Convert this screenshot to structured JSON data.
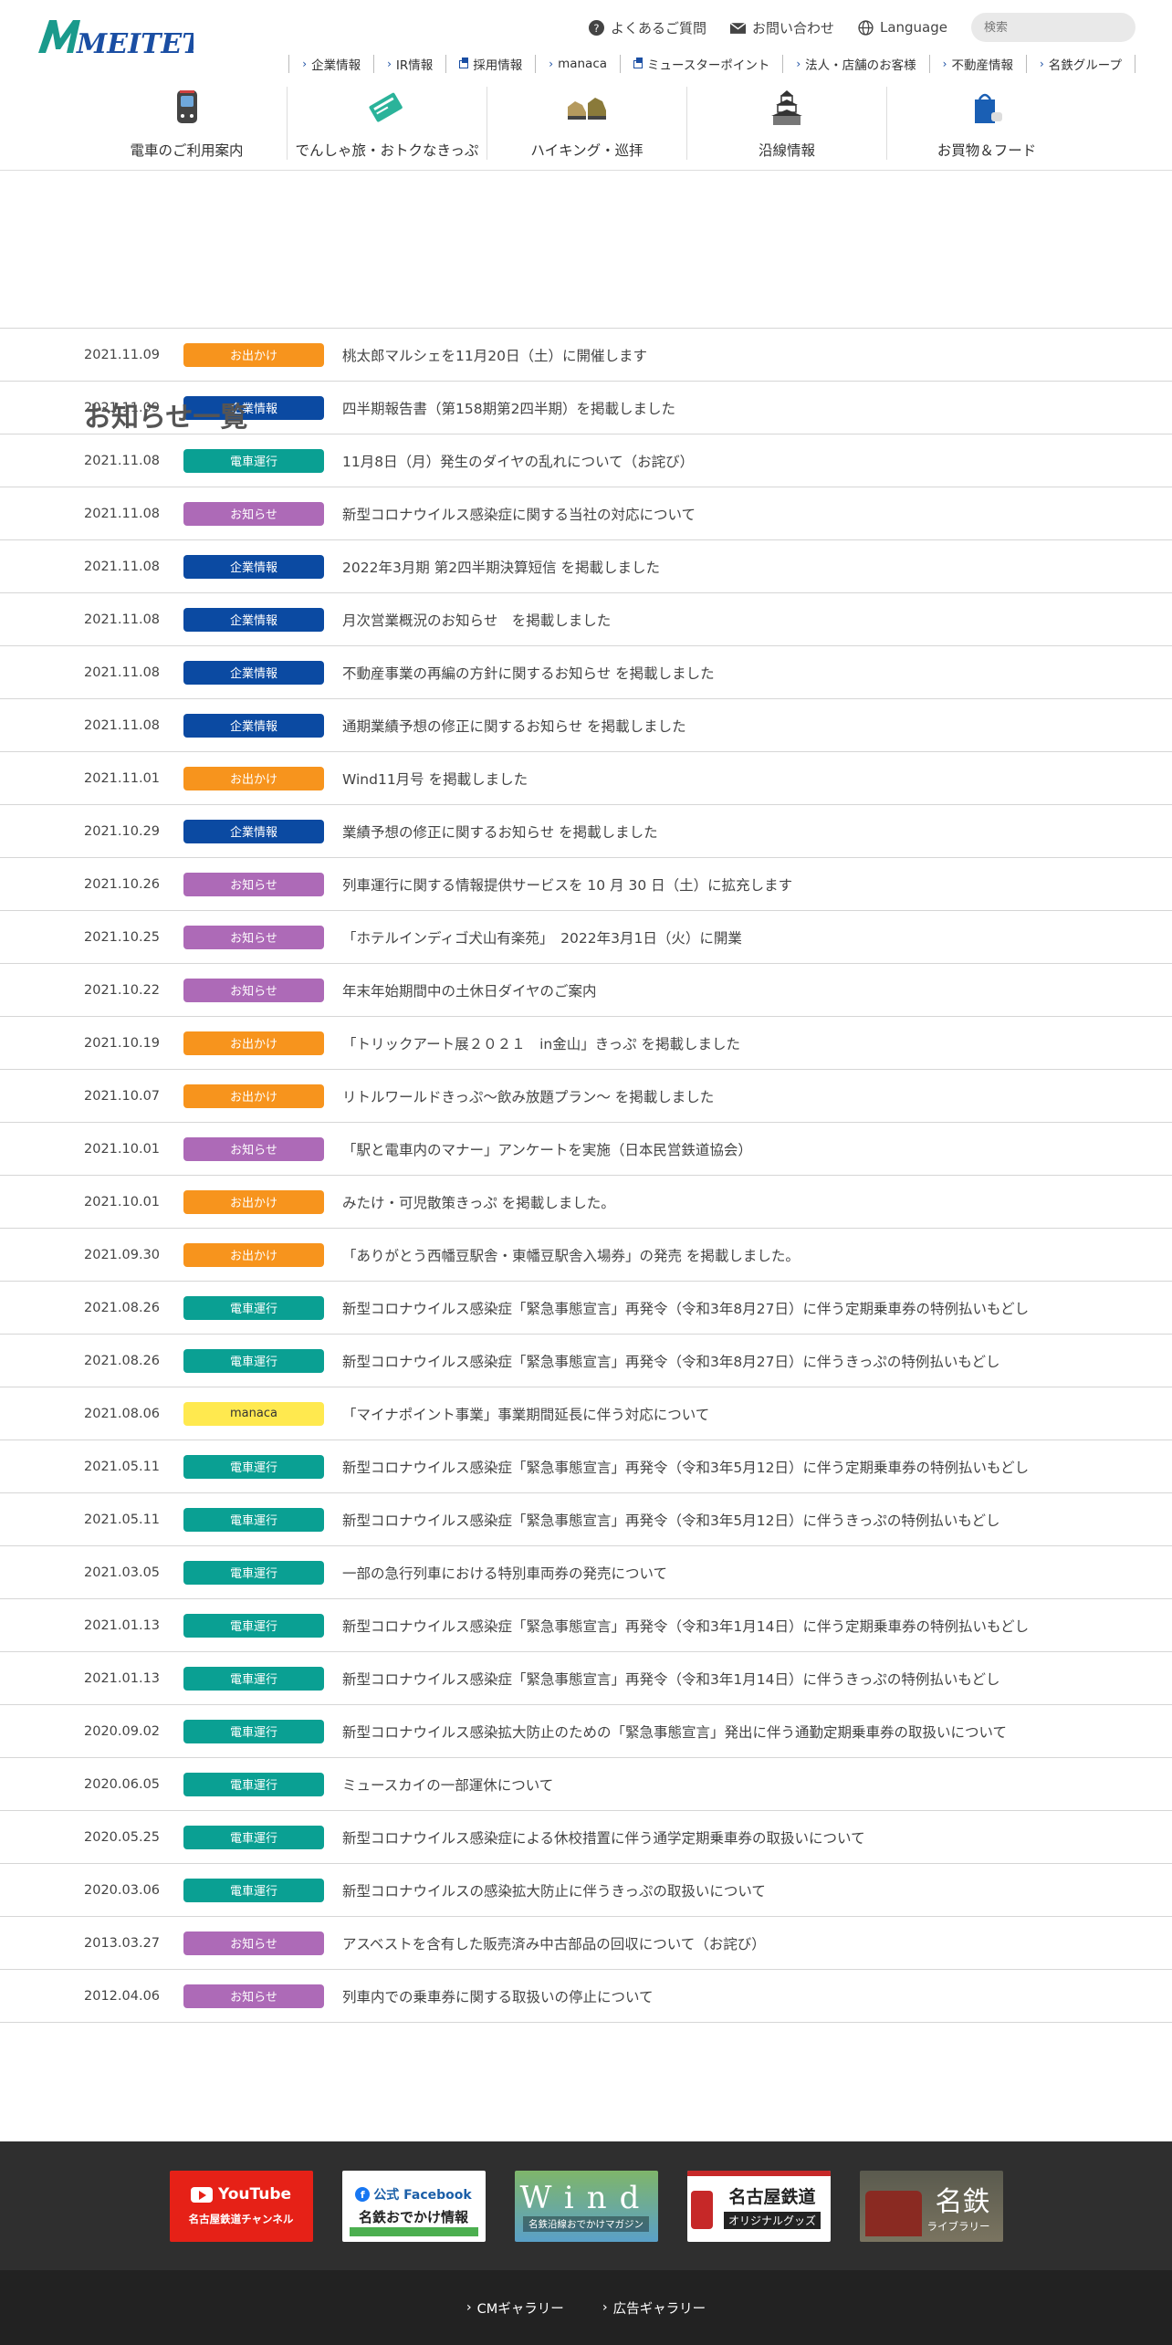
{
  "brand": {
    "logo_text": "MEITETSU",
    "logo_color": "#1a9a8c"
  },
  "util_nav": {
    "faq": "よくあるご質問",
    "contact": "お問い合わせ",
    "language": "Language",
    "search_placeholder": "検索"
  },
  "corp_nav": [
    {
      "label": "企業情報",
      "ext": false
    },
    {
      "label": "IR情報",
      "ext": false
    },
    {
      "label": "採用情報",
      "ext": true
    },
    {
      "label": "manaca",
      "ext": false
    },
    {
      "label": "ミュースターポイント",
      "ext": true
    },
    {
      "label": "法人・店舗のお客様",
      "ext": false
    },
    {
      "label": "不動産情報",
      "ext": false
    },
    {
      "label": "名鉄グループ",
      "ext": false
    }
  ],
  "main_nav": [
    {
      "label": "電車のご利用案内",
      "icon": "train-icon"
    },
    {
      "label": "でんしゃ旅・おトクなきっぷ",
      "icon": "ticket-icon"
    },
    {
      "label": "ハイキング・巡拝",
      "icon": "hiking-boots-icon"
    },
    {
      "label": "沿線情報",
      "icon": "castle-icon"
    },
    {
      "label": "お買物＆フード",
      "icon": "shopping-bag-icon"
    }
  ],
  "page_title": "お知らせ一覧",
  "categories": {
    "odekake": {
      "label": "お出かけ",
      "color": "#f7941d"
    },
    "kigyo": {
      "label": "企業情報",
      "color": "#0b4aa2"
    },
    "densha": {
      "label": "電車運行",
      "color": "#0aa093"
    },
    "oshirase": {
      "label": "お知らせ",
      "color": "#ad6ab7"
    },
    "manaca": {
      "label": "manaca",
      "color": "#ffe94f"
    }
  },
  "news": [
    {
      "date": "2021.11.09",
      "cat": "odekake",
      "title": "桃太郎マルシェを11月20日（土）に開催します"
    },
    {
      "date": "2021.11.09",
      "cat": "kigyo",
      "title": "四半期報告書（第158期第2四半期）を掲載しました"
    },
    {
      "date": "2021.11.08",
      "cat": "densha",
      "title": "11月8日（月）発生のダイヤの乱れについて（お詫び）"
    },
    {
      "date": "2021.11.08",
      "cat": "oshirase",
      "title": "新型コロナウイルス感染症に関する当社の対応について"
    },
    {
      "date": "2021.11.08",
      "cat": "kigyo",
      "title": "2022年3月期 第2四半期決算短信 を掲載しました"
    },
    {
      "date": "2021.11.08",
      "cat": "kigyo",
      "title": "月次営業概況のお知らせ　を掲載しました"
    },
    {
      "date": "2021.11.08",
      "cat": "kigyo",
      "title": "不動産事業の再編の方針に関するお知らせ を掲載しました"
    },
    {
      "date": "2021.11.08",
      "cat": "kigyo",
      "title": "通期業績予想の修正に関するお知らせ を掲載しました"
    },
    {
      "date": "2021.11.01",
      "cat": "odekake",
      "title": "Wind11月号 を掲載しました"
    },
    {
      "date": "2021.10.29",
      "cat": "kigyo",
      "title": "業績予想の修正に関するお知らせ を掲載しました"
    },
    {
      "date": "2021.10.26",
      "cat": "oshirase",
      "title": "列車運行に関する情報提供サービスを 10 月 30 日（土）に拡充します"
    },
    {
      "date": "2021.10.25",
      "cat": "oshirase",
      "title": "「ホテルインディゴ犬山有楽苑」　2022年3月1日（火）に開業"
    },
    {
      "date": "2021.10.22",
      "cat": "oshirase",
      "title": "年末年始期間中の土休日ダイヤのご案内"
    },
    {
      "date": "2021.10.19",
      "cat": "odekake",
      "title": "「トリックアート展２０２１　in金山」きっぷ を掲載しました"
    },
    {
      "date": "2021.10.07",
      "cat": "odekake",
      "title": "リトルワールドきっぷ～飲み放題プラン～ を掲載しました"
    },
    {
      "date": "2021.10.01",
      "cat": "oshirase",
      "title": "「駅と電車内のマナー」アンケートを実施（日本民営鉄道協会）"
    },
    {
      "date": "2021.10.01",
      "cat": "odekake",
      "title": "みたけ・可児散策きっぷ を掲載しました。"
    },
    {
      "date": "2021.09.30",
      "cat": "odekake",
      "title": "「ありがとう西幡豆駅舎・東幡豆駅舎入場券」の発売 を掲載しました。"
    },
    {
      "date": "2021.08.26",
      "cat": "densha",
      "title": "新型コロナウイルス感染症「緊急事態宣言」再発令（令和3年8月27日）に伴う定期乗車券の特例払いもどし"
    },
    {
      "date": "2021.08.26",
      "cat": "densha",
      "title": "新型コロナウイルス感染症「緊急事態宣言」再発令（令和3年8月27日）に伴うきっぷの特例払いもどし"
    },
    {
      "date": "2021.08.06",
      "cat": "manaca",
      "title": "「マイナポイント事業」事業期間延長に伴う対応について"
    },
    {
      "date": "2021.05.11",
      "cat": "densha",
      "title": "新型コロナウイルス感染症「緊急事態宣言」再発令（令和3年5月12日）に伴う定期乗車券の特例払いもどし"
    },
    {
      "date": "2021.05.11",
      "cat": "densha",
      "title": "新型コロナウイルス感染症「緊急事態宣言」再発令（令和3年5月12日）に伴うきっぷの特例払いもどし"
    },
    {
      "date": "2021.03.05",
      "cat": "densha",
      "title": "一部の急行列車における特別車両券の発売について"
    },
    {
      "date": "2021.01.13",
      "cat": "densha",
      "title": "新型コロナウイルス感染症「緊急事態宣言」再発令（令和3年1月14日）に伴う定期乗車券の特例払いもどし"
    },
    {
      "date": "2021.01.13",
      "cat": "densha",
      "title": "新型コロナウイルス感染症「緊急事態宣言」再発令（令和3年1月14日）に伴うきっぷの特例払いもどし"
    },
    {
      "date": "2020.09.02",
      "cat": "densha",
      "title": "新型コロナウイルス感染拡大防止のための「緊急事態宣言」発出に伴う通勤定期乗車券の取扱いについて"
    },
    {
      "date": "2020.06.05",
      "cat": "densha",
      "title": "ミュースカイの一部運休について"
    },
    {
      "date": "2020.05.25",
      "cat": "densha",
      "title": "新型コロナウイルス感染症による休校措置に伴う通学定期乗車券の取扱いについて"
    },
    {
      "date": "2020.03.06",
      "cat": "densha",
      "title": "新型コロナウイルスの感染拡大防止に伴うきっぷの取扱いについて"
    },
    {
      "date": "2013.03.27",
      "cat": "oshirase",
      "title": "アスベストを含有した販売済み中古部品の回収について（お詫び）"
    },
    {
      "date": "2012.04.06",
      "cat": "oshirase",
      "title": "列車内での乗車券に関する取扱いの停止について"
    }
  ],
  "footer": {
    "banners": {
      "youtube_title": "YouTube",
      "youtube_sub": "名古屋鉄道チャンネル",
      "facebook_title": "公式 Facebook",
      "facebook_sub": "名鉄おでかけ情報",
      "wind_title": "Wind",
      "wind_sub": "名鉄沿線おでかけマガジン",
      "goods_title": "名古屋鉄道",
      "goods_sub": "オリジナルグッズ",
      "library_title": "名鉄",
      "library_sub": "ライブラリー"
    },
    "links": [
      "CMギャラリー",
      "広告ギャラリー"
    ]
  }
}
